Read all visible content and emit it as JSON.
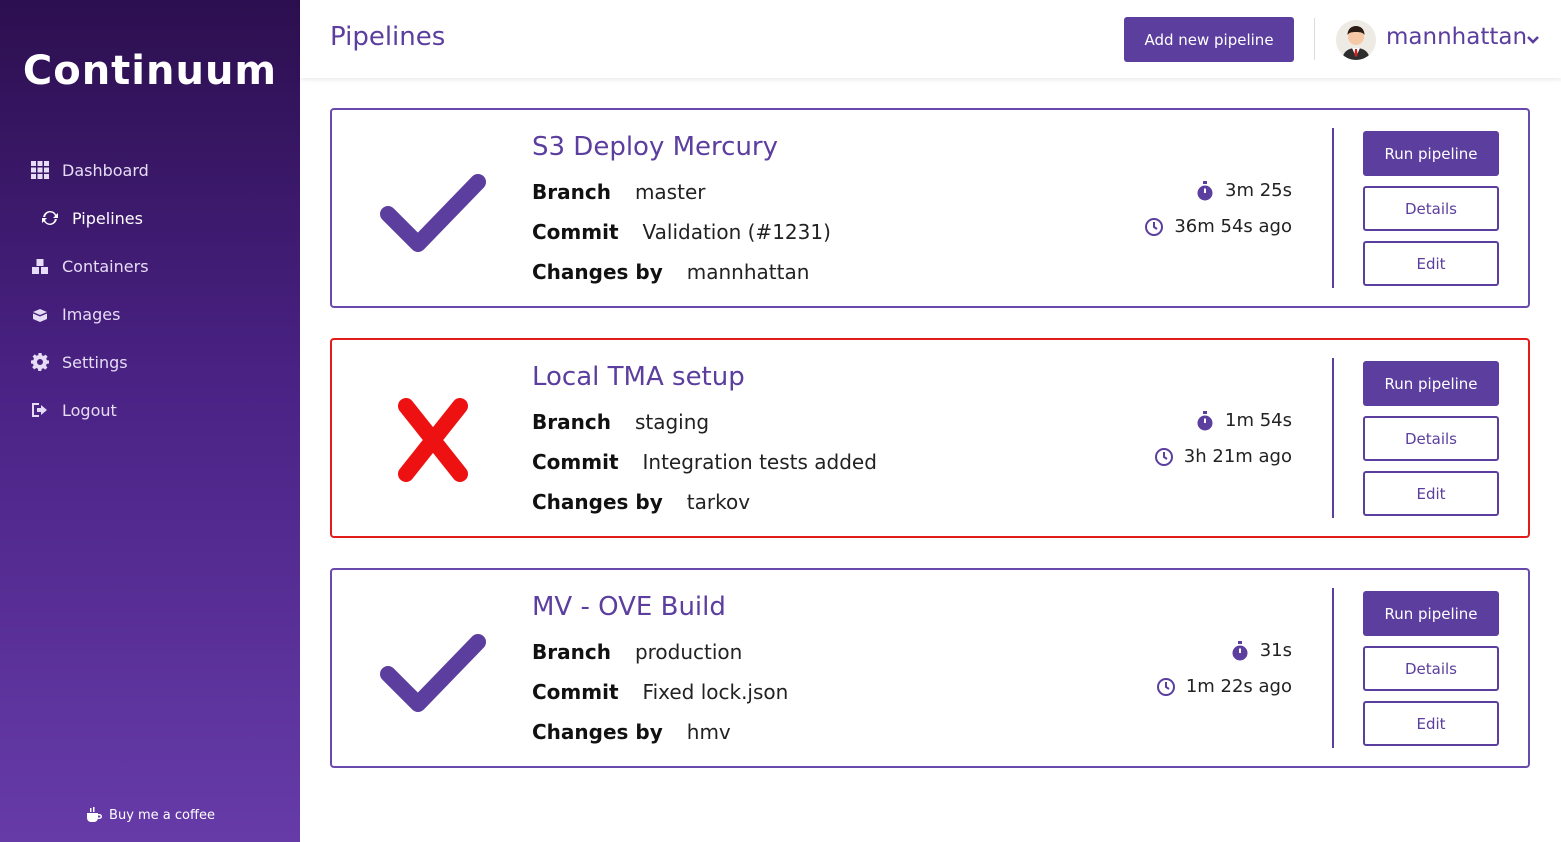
{
  "sidebar": {
    "logo": "Continuum",
    "items": [
      {
        "label": "Dashboard"
      },
      {
        "label": "Pipelines"
      },
      {
        "label": "Containers"
      },
      {
        "label": "Images"
      },
      {
        "label": "Settings"
      },
      {
        "label": "Logout"
      }
    ],
    "footer": "Buy me a coffee"
  },
  "header": {
    "title": "Pipelines",
    "add_button": "Add new pipeline",
    "username": "mannhattan"
  },
  "labels": {
    "branch": "Branch",
    "commit": "Commit",
    "changes_by": "Changes by",
    "run": "Run pipeline",
    "details": "Details",
    "edit": "Edit"
  },
  "pipelines": [
    {
      "title": "S3 Deploy Mercury",
      "status": "success",
      "branch": "master",
      "commit": "Validation (#1231)",
      "changes_by": "mannhattan",
      "duration": "3m 25s",
      "ago": "36m 54s ago"
    },
    {
      "title": "Local TMA setup",
      "status": "failed",
      "branch": "staging",
      "commit": "Integration tests added",
      "changes_by": "tarkov",
      "duration": "1m 54s",
      "ago": "3h 21m ago"
    },
    {
      "title": "MV - OVE Build",
      "status": "success",
      "branch": "production",
      "commit": "Fixed lock.json",
      "changes_by": "hmv",
      "duration": "31s",
      "ago": "1m 22s ago"
    }
  ],
  "colors": {
    "accent": "#5b3e9e",
    "success": "#5b3e9e",
    "failed": "#ee1111"
  }
}
